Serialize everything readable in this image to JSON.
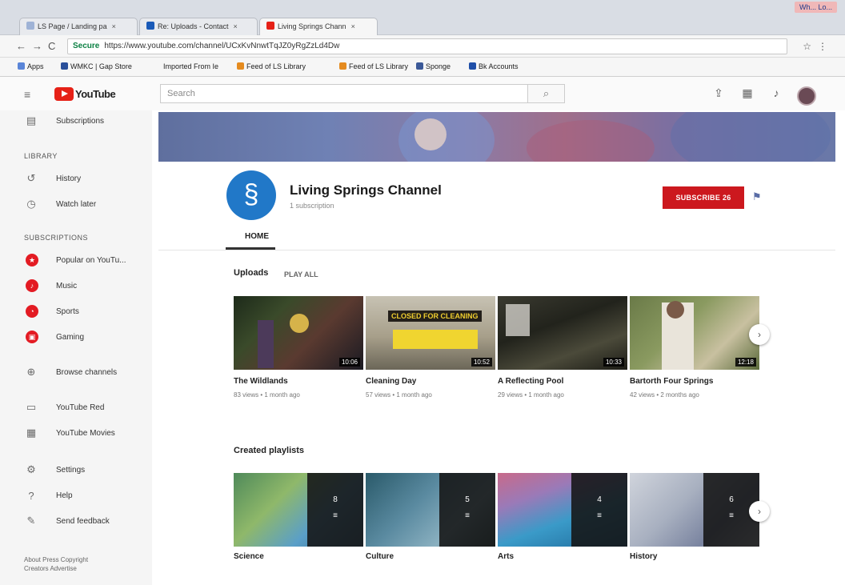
{
  "browser": {
    "tabs": [
      {
        "label": "LS Page / Landing pa"
      },
      {
        "label": "Re: Uploads - Contact"
      },
      {
        "label": "Living Springs Chann"
      }
    ],
    "profile": "Wh... Lo... ",
    "secure_label": "Secure",
    "url": "https://www.youtube.com/channel/UCxKvNnwtTqJZ0yRgZzLd4Dw",
    "bookmarks": [
      {
        "label": "Apps"
      },
      {
        "label": "WMKC | Gap Store"
      },
      {
        "label": "Imported From Ie"
      },
      {
        "label": "Feed of LS Library"
      },
      {
        "label": "Feed of LS Library"
      },
      {
        "label": "Sponge"
      },
      {
        "label": "Bk Accounts"
      }
    ]
  },
  "youtube": {
    "logo_text": "YouTube",
    "search_placeholder": "Search"
  },
  "sidebar": {
    "subscriptions_item": "Subscriptions",
    "library_heading": "LIBRARY",
    "library": [
      {
        "label": "History",
        "icon": "history-icon"
      },
      {
        "label": "Watch later",
        "icon": "clock-icon"
      }
    ],
    "subscriptions_heading": "SUBSCRIPTIONS",
    "subscriptions": [
      {
        "label": "Popular on YouTu...",
        "color": "#e31b23"
      },
      {
        "label": "Music",
        "color": "#e31b23"
      },
      {
        "label": "Sports",
        "color": "#e31b23"
      },
      {
        "label": "Gaming",
        "color": "#e31b23"
      }
    ],
    "browse_channels": "Browse channels",
    "more": [
      {
        "label": "YouTube Red"
      },
      {
        "label": "YouTube Movies"
      }
    ],
    "settings_items": [
      {
        "label": "Settings"
      },
      {
        "label": "Help"
      },
      {
        "label": "Send feedback"
      }
    ],
    "footer_line1": "About  Press  Copyright",
    "footer_line2": "Creators  Advertise"
  },
  "channel": {
    "name": "Living Springs Channel",
    "subscriber_text": "1 subscription",
    "subscribe_label": "SUBSCRIBE 26",
    "home_tab": "HOME",
    "accent_color": "#cc181e"
  },
  "uploads": {
    "title": "Uploads",
    "play_all": "PLAY ALL",
    "videos": [
      {
        "title": "The Wildlands",
        "meta": "83 views • 1 month ago",
        "duration": "10:06"
      },
      {
        "title": "Cleaning Day",
        "meta": "57 views • 1 month ago",
        "duration": "10:52",
        "overlay": "CLOSED FOR CLEANING"
      },
      {
        "title": "A Reflecting Pool",
        "meta": "29 views • 1 month ago",
        "duration": "10:33"
      },
      {
        "title": "Bartorth Four Springs",
        "meta": "42 views • 2 months ago",
        "duration": "12:18"
      }
    ]
  },
  "playlists": {
    "title": "Created playlists",
    "items": [
      {
        "title": "Science",
        "count": "8"
      },
      {
        "title": "Culture",
        "count": "5"
      },
      {
        "title": "Arts",
        "count": "4"
      },
      {
        "title": "History",
        "count": "6"
      }
    ]
  }
}
